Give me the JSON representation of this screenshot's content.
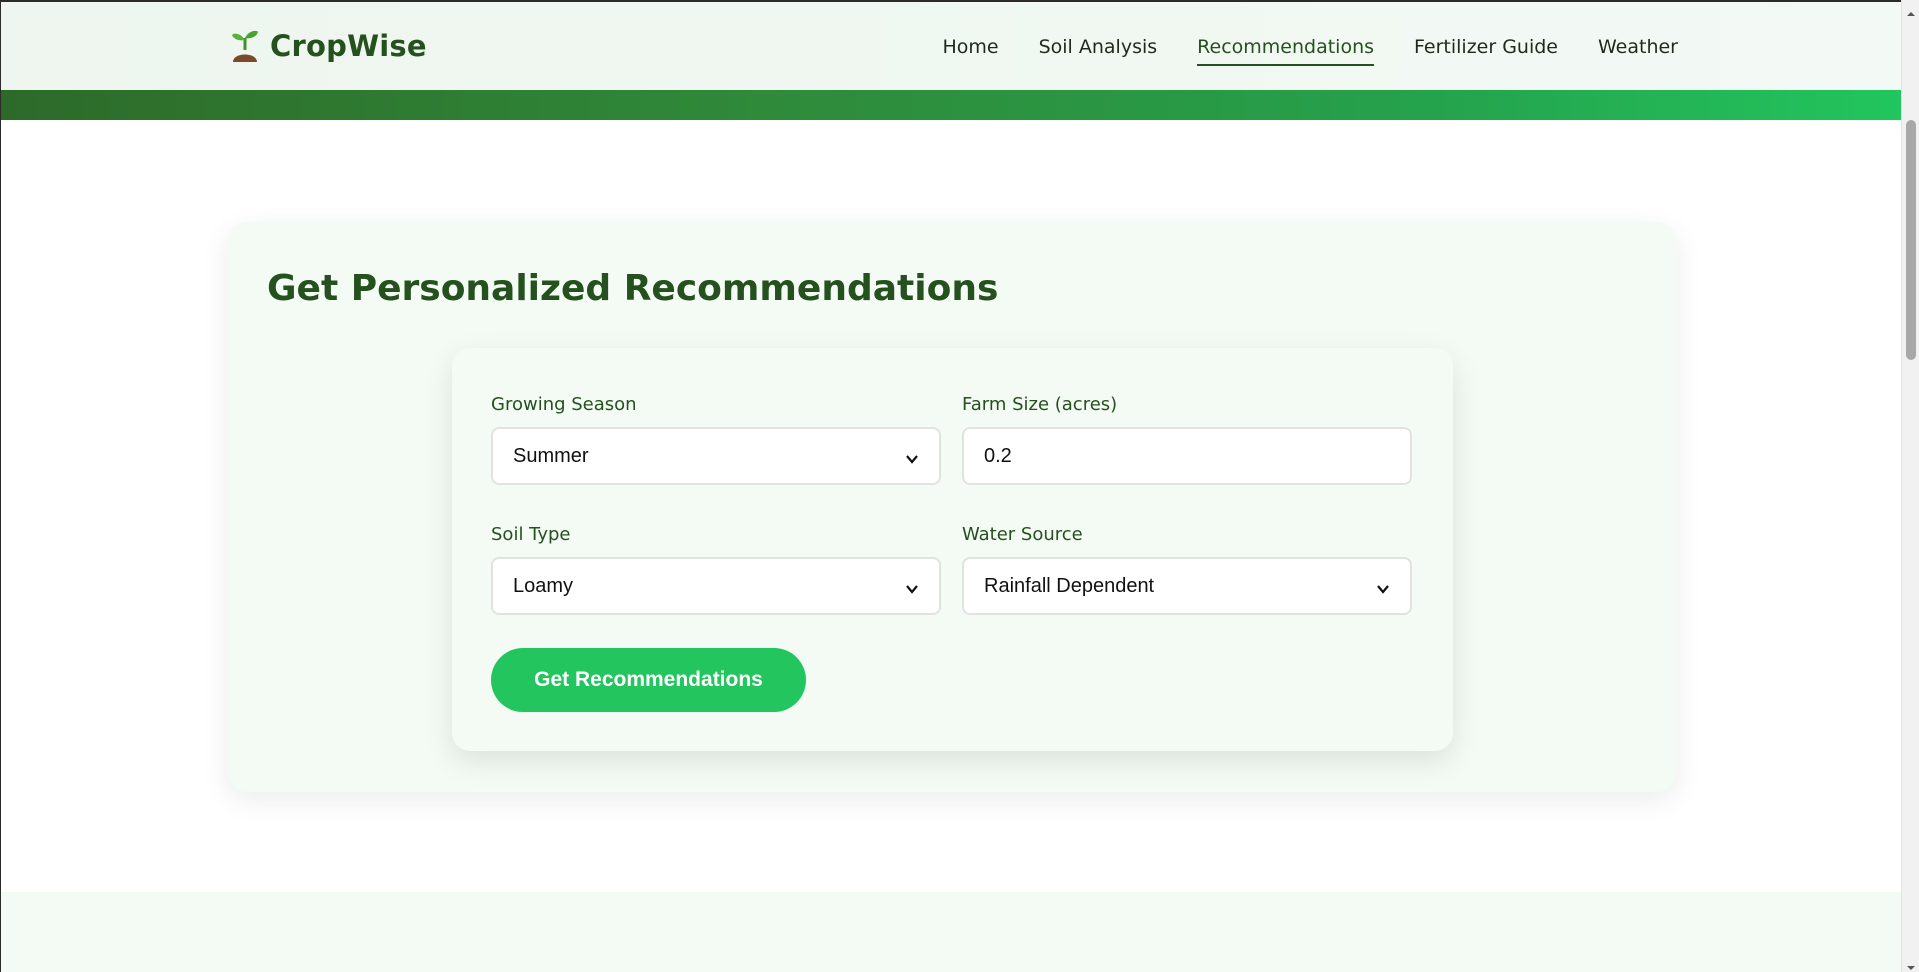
{
  "app": {
    "name": "CropWise",
    "logo_icon": "seedling-icon"
  },
  "nav": {
    "items": [
      {
        "label": "Home",
        "active": false
      },
      {
        "label": "Soil Analysis",
        "active": false
      },
      {
        "label": "Recommendations",
        "active": true
      },
      {
        "label": "Fertilizer Guide",
        "active": false
      },
      {
        "label": "Weather",
        "active": false
      }
    ]
  },
  "main": {
    "title": "Get Personalized Recommendations",
    "form": {
      "growing_season": {
        "label": "Growing Season",
        "value": "Summer"
      },
      "farm_size": {
        "label": "Farm Size (acres)",
        "value": "0.2"
      },
      "soil_type": {
        "label": "Soil Type",
        "value": "Loamy"
      },
      "water_source": {
        "label": "Water Source",
        "value": "Rainfall Dependent"
      },
      "submit_label": "Get Recommendations"
    }
  },
  "colors": {
    "brand_dark": "#24511d",
    "accent": "#22c55e",
    "panel": "#f4faf4"
  }
}
